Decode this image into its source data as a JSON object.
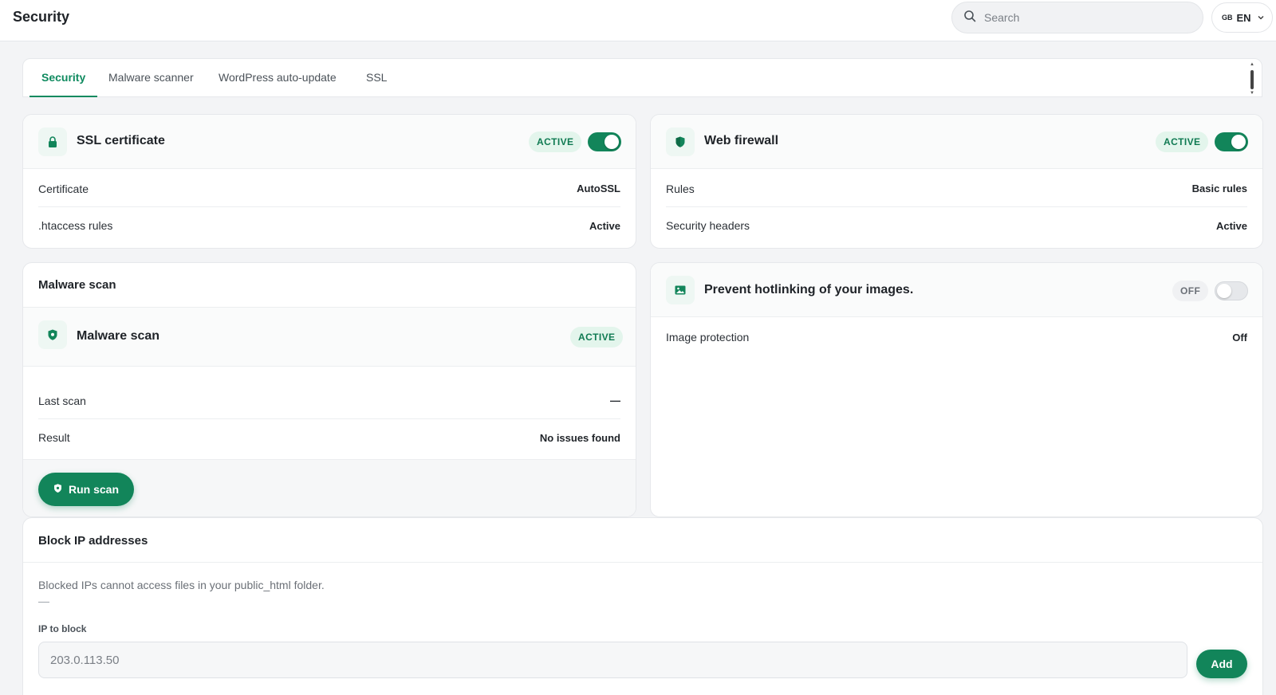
{
  "header": {
    "title": "Security",
    "search_placeholder": "Search",
    "lang_flag": "GB",
    "lang_code": "EN"
  },
  "tabs": [
    {
      "label": "Security",
      "active": true
    },
    {
      "label": "Malware scanner",
      "active": false
    },
    {
      "label": "WordPress auto-update",
      "active": false
    },
    {
      "label": "SSL",
      "active": false
    }
  ],
  "ssl_card": {
    "title": "SSL certificate",
    "status": "ACTIVE",
    "enabled": true,
    "rows": [
      {
        "label": "Certificate",
        "value": "AutoSSL"
      },
      {
        "label": ".htaccess rules",
        "value": "Active"
      }
    ]
  },
  "firewall_card": {
    "title": "Web firewall",
    "status": "ACTIVE",
    "enabled": true,
    "rows": [
      {
        "label": "Rules",
        "value": "Basic rules"
      },
      {
        "label": "Security headers",
        "value": "Active"
      }
    ]
  },
  "malware_card": {
    "title": "Malware scan",
    "sub_title": "Malware scan",
    "status": "ACTIVE",
    "rows": [
      {
        "label": "Last scan",
        "value": "—"
      },
      {
        "label": "Result",
        "value": "No issues found"
      }
    ],
    "button_label": "Run scan"
  },
  "hotlink_card": {
    "title": "Prevent hotlinking of your images.",
    "status": "OFF",
    "enabled": false,
    "rows": [
      {
        "label": "Image protection",
        "value": "Off"
      }
    ]
  },
  "block_ip": {
    "title": "Block IP addresses",
    "help_text": "Blocked IPs cannot access files in your public_html folder.",
    "list_placeholder": "—",
    "field_label": "IP to block",
    "input_placeholder": "203.0.113.50",
    "button_label": "Add"
  },
  "colors": {
    "accent": "#12855a",
    "active_badge_bg": "#e3f5ec",
    "page_bg": "#f3f4f6"
  },
  "icons": {
    "search": "search-icon",
    "chevron": "chevron-down-icon",
    "lock": "lock-icon",
    "shield": "shield-icon",
    "image": "image-icon"
  }
}
